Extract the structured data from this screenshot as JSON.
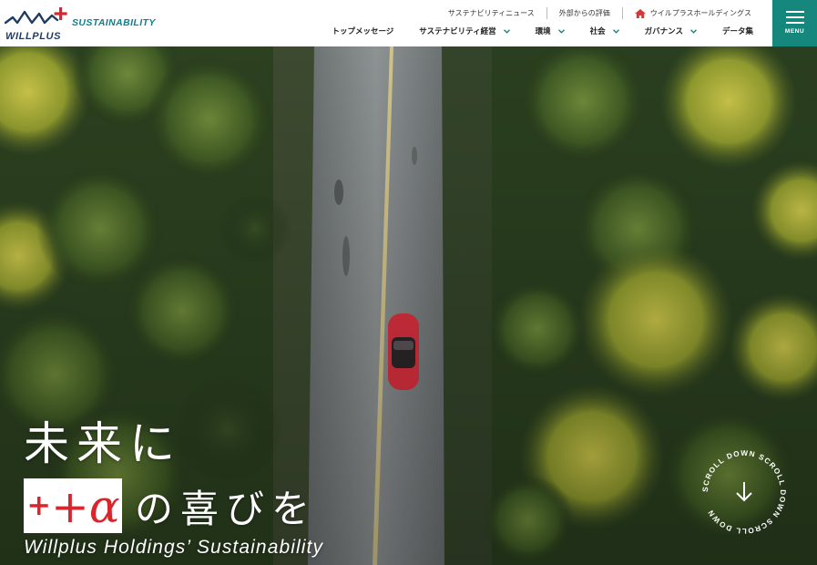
{
  "brand": {
    "logo_word": "WILLPLUS",
    "logo_sub": "SUSTAINABILITY"
  },
  "util_nav": [
    {
      "label": "サステナビリティニュース"
    },
    {
      "label": "外部からの評価"
    },
    {
      "label": "ウイルプラスホールディングス",
      "icon": "home-icon"
    }
  ],
  "main_nav": [
    {
      "label": "トップメッセージ",
      "dropdown": false
    },
    {
      "label": "サステナビリティ経営",
      "dropdown": true
    },
    {
      "label": "環境",
      "dropdown": true
    },
    {
      "label": "社会",
      "dropdown": true
    },
    {
      "label": "ガバナンス",
      "dropdown": true
    },
    {
      "label": "データ集",
      "dropdown": false
    }
  ],
  "menu_button": {
    "label": "MENU"
  },
  "hero": {
    "line1": "未来に",
    "badge": "+α",
    "line2": "の喜びを",
    "subtitle": "Willplus Holdings’ Sustainability",
    "scroll_text": "SCROLL DOWN SCROLL DOWN SCROLL DOWN "
  },
  "colors": {
    "teal": "#16877d",
    "logo_red": "#d9262c",
    "logo_navy": "#1f3c5e",
    "home_icon": "#d23a3a"
  }
}
